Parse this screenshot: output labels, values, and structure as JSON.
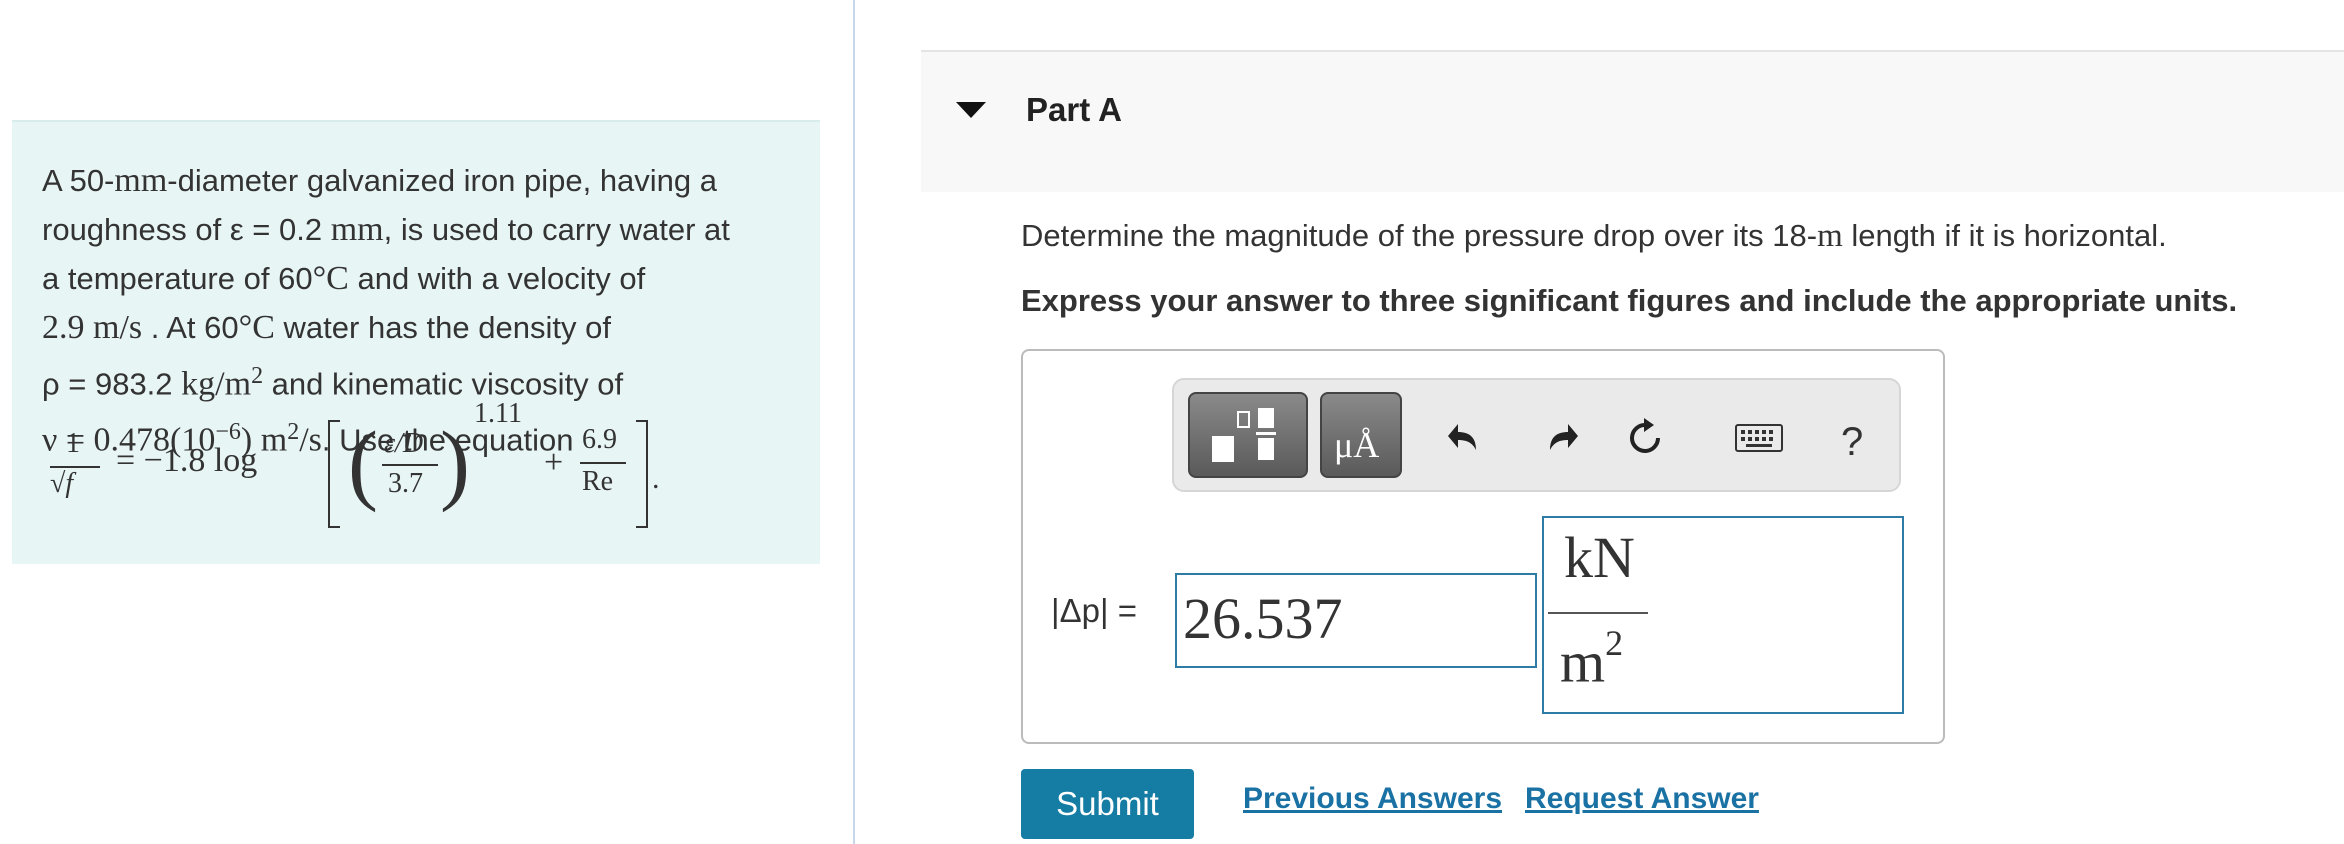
{
  "problem": {
    "line1_a": "A 50-",
    "line1_m": "mm",
    "line1_b": "-diameter galvanized iron pipe, having a",
    "line2_a": "roughness of ε = 0.2 ",
    "line2_m": "mm",
    "line2_b": ", is used to carry water at",
    "line3_a": "a temperature of 60",
    "line3_m": "°C",
    "line3_b": " and with a velocity of",
    "line4_m": "2.9  m/s",
    "line4_b": " . At 60",
    "line4_m2": "°C",
    "line4_c": " water has the density of",
    "line5_a": "ρ = 983.2 ",
    "line5_m": "kg/m",
    "line5_sup": "2",
    "line5_b": "  and kinematic viscosity of",
    "line6_m": "ν = 0.478(10",
    "line6_sup1": "−6",
    "line6_m2": ") m",
    "line6_sup2": "2",
    "line6_m3": "/s",
    "line6_b": ". Use the equation",
    "equation": {
      "num1": "1",
      "den1": "√f",
      "eq_rhs": "= −1.8 log",
      "frac_num": "ε/D",
      "frac_den": "3.7",
      "exponent": "1.11",
      "plus": "+",
      "num2": "6.9",
      "den2": "Re",
      "period": "."
    }
  },
  "part": {
    "title": "Part A"
  },
  "question": {
    "text_a": "Determine the magnitude of the pressure drop over its 18-",
    "text_m": "m",
    "text_b": " length if it is horizontal.",
    "instruction": "Express your answer to three significant figures and include the appropriate units."
  },
  "toolbar": {
    "units_label": "μÅ",
    "help_label": "?"
  },
  "answer": {
    "label": "|Δp| =",
    "value": "26.537",
    "unit_numerator": "kN",
    "unit_denominator": "m",
    "unit_denominator_exp": "2"
  },
  "actions": {
    "submit": "Submit",
    "previous_answers": "Previous Answers",
    "request_answer": "Request Answer"
  }
}
